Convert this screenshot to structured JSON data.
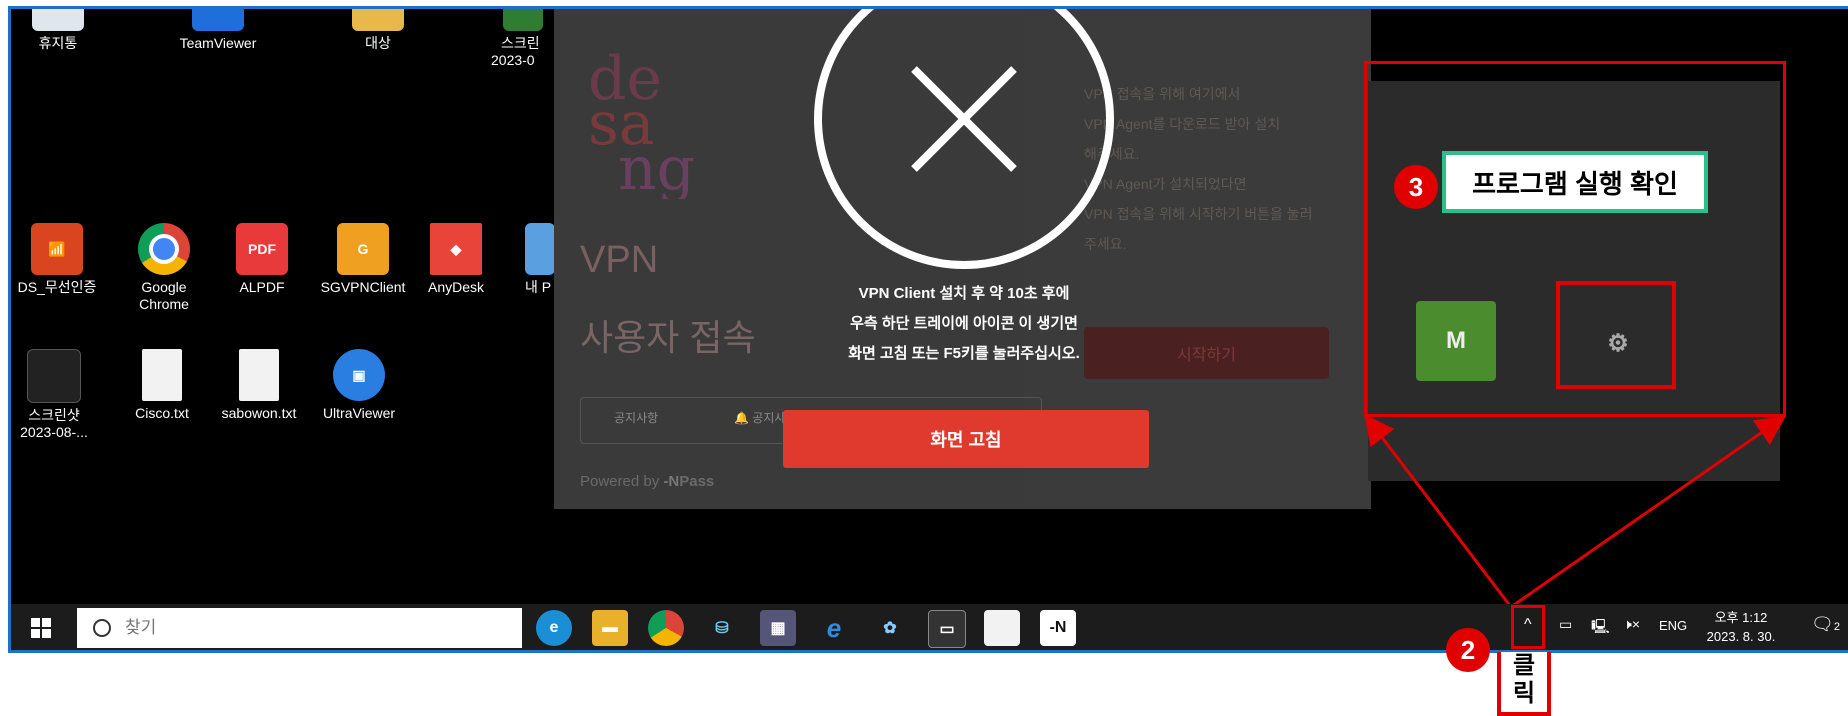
{
  "desktop_icons": [
    {
      "label": "휴지통"
    },
    {
      "label": "TeamViewer"
    },
    {
      "label": "대상"
    },
    {
      "label": "스크린",
      "sub": "2023-0"
    },
    {
      "label": "DS_무선인증"
    },
    {
      "label": "Google Chrome"
    },
    {
      "label": "ALPDF"
    },
    {
      "label": "SGVPNClient"
    },
    {
      "label": "AnyDesk"
    },
    {
      "label": "내 P"
    },
    {
      "label": "스크린샷",
      "sub": "2023-08-..."
    },
    {
      "label": "Cisco.txt"
    },
    {
      "label": "sabowon.txt"
    },
    {
      "label": "UltraViewer"
    }
  ],
  "dialog": {
    "title": "VPN",
    "subtitle": "사용자 접속",
    "notice_tab": "공지사항",
    "notice_tab2": "공지사",
    "powered_by": "Powered by",
    "powered_brand": "Pass",
    "right_text": [
      "VPN 접속을 위해 여기에서",
      "VPN Agent를 다운로드 받아 설치",
      "해주세요.",
      "VPN Agent가 설치되었다면",
      "VPN 접속을 위해 시작하기 버튼을 눌러",
      "주세요."
    ],
    "start_button": "시작하기",
    "overlay_lines": [
      "VPN Client 설치 후 약 10초 후에",
      "우측 하단 트레이에 아이콘 이 생기면",
      "화면 고침 또는 F5키를 눌러주십시오."
    ],
    "refresh_button": "화면 고침"
  },
  "callouts": {
    "step3_number": "3",
    "step3_label": "프로그램 실행 확인",
    "step2_number": "2",
    "step2_label": "클릭"
  },
  "taskbar": {
    "search_placeholder": "찾기",
    "tray_lang": "ENG",
    "time": "오후 1:12",
    "date": "2023. 8. 30.",
    "notification_count": "2",
    "overflow_chevron": "^"
  },
  "colors": {
    "accent_red": "#e00000",
    "callout_green": "#2bbf8c",
    "refresh_button": "#e03a2e",
    "frame_blue": "#1f6fd1"
  }
}
